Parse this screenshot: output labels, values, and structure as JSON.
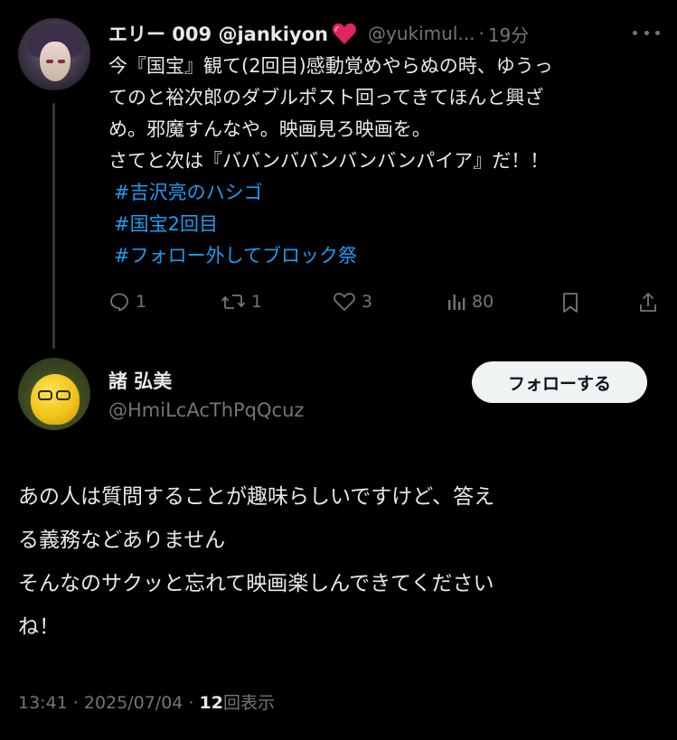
{
  "parent_tweet": {
    "display_name": "エリー 009 @jankiyon",
    "handle": "@yukimul...",
    "separator": "·",
    "time_ago": "19分",
    "text_lines": [
      "今『国宝』観て(2回目)感動覚めやらぬの時、ゆうっ",
      "てのと裕次郎のダブルポスト回ってきてほんと興ざ",
      "め。邪魔すんなや。映画見ろ映画を。",
      "さてと次は『ババンババンバンバンパイア』だ！！"
    ],
    "hashtags": [
      "#吉沢亮のハシゴ",
      "#国宝2回目",
      "#フォロー外してブロック祭"
    ],
    "actions": {
      "replies": "1",
      "reposts": "1",
      "likes": "3",
      "views": "80"
    },
    "icons": [
      "heart-emoji-icon",
      "more-icon",
      "reply-icon",
      "repost-icon",
      "like-icon",
      "views-icon",
      "bookmark-icon",
      "share-icon"
    ]
  },
  "reply": {
    "display_name": "諸 弘美",
    "handle": "@HmiLcAcThPqQcuz",
    "follow_label": "フォローする",
    "text_lines": [
      "あの人は質問することが趣味らしいですけど、答え",
      "る義務などありません",
      "そんなのサクッと忘れて映画楽しんできてください",
      "ね！"
    ],
    "timestamp": "13:41 · 2025/07/04 · ",
    "view_count": "12",
    "view_label": "回表示"
  },
  "colors": {
    "background": "#000000",
    "text": "#e7e9ea",
    "muted": "#71767b",
    "link": "#1d9bf0",
    "heart": "#e0245e"
  }
}
